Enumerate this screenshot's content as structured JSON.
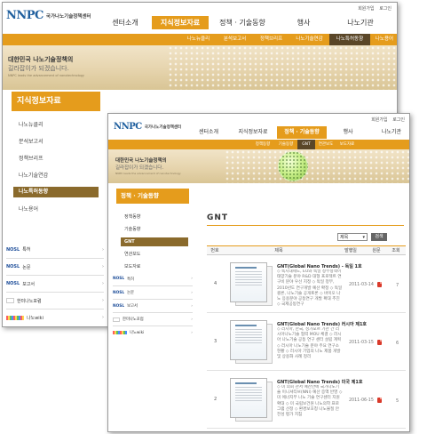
{
  "back": {
    "utility": [
      "회원가입",
      "로그인"
    ],
    "logo_mark": "NNPC",
    "logo_text": "국가나노기술정책센터",
    "gnb": [
      "센터소개",
      "지식정보자료",
      "정책 · 기술동향",
      "행사",
      "나노기관"
    ],
    "gnb_active_index": 1,
    "subnav": [
      "나노뉴클리",
      "분석보고서",
      "정책브리프",
      "나노기술연감",
      "나노특허동향",
      "나노용어"
    ],
    "subnav_active_index": 4,
    "banner_title": "대한민국 나노기술정책의",
    "banner_sub": "길라잡이가 되겠습니다.",
    "banner_tiny": "NNPC leads the advancement of nanotechnology",
    "lnb_title": "지식정보자료",
    "lnb_items": [
      "나노뉴클리",
      "분석보고서",
      "정책브리프",
      "나노기술연감",
      "나노특허동향",
      "나노용어"
    ],
    "lnb_active_index": 4,
    "quick": [
      {
        "logo": "NOSL",
        "label": "특허",
        "icon": "nosl-logo"
      },
      {
        "logo": "NOSL",
        "label": "논문",
        "icon": "nosl-logo"
      },
      {
        "logo": "NOSL",
        "label": "보고서",
        "icon": "nosl-logo"
      },
      {
        "logo": "",
        "label": "한미나노포럼",
        "icon": "korea-flag-icon"
      },
      {
        "logo": "",
        "label": "나노wiki",
        "icon": "wiki-icon"
      }
    ]
  },
  "front": {
    "utility": [
      "회원가입",
      "로그인"
    ],
    "logo_mark": "NNPC",
    "logo_text": "국가나노기술정책센터",
    "gnb": [
      "센터소개",
      "지식정보자료",
      "정책 · 기술동향",
      "행사",
      "나노기관"
    ],
    "gnb_active_index": 2,
    "subnav": [
      "정책동향",
      "기술동향",
      "GNT",
      "연관보도",
      "보도자료"
    ],
    "subnav_active_index": 2,
    "banner_title": "대한민국 나노기술정책의",
    "banner_sub": "길라잡이가 되겠습니다.",
    "banner_tiny": "NNPC leads the advancement of nanotechnology",
    "lnb_title": "정책 · 기술동향",
    "lnb_items": [
      "정책동향",
      "기술동향",
      "GNT",
      "연관보도",
      "보도자료"
    ],
    "lnb_active_index": 2,
    "quick": [
      {
        "logo": "NOSL",
        "label": "특허",
        "icon": "nosl-logo"
      },
      {
        "logo": "NOSL",
        "label": "논문",
        "icon": "nosl-logo"
      },
      {
        "logo": "NOSL",
        "label": "보고서",
        "icon": "nosl-logo"
      },
      {
        "logo": "",
        "label": "한미나노포럼",
        "icon": "korea-flag-icon"
      },
      {
        "logo": "",
        "label": "나노wiki",
        "icon": "wiki-icon"
      }
    ],
    "content_title": "GNT",
    "filter_value": "제목",
    "go_label": "검색",
    "table_headers": [
      "번호",
      "제목",
      "발행일",
      "원문",
      "조회"
    ],
    "rows": [
      {
        "no": "4",
        "title": "GNT(Global Nano Trends) - 독일 1호",
        "desc": "◇ 독시대제도, EU와 독일 정부정책이 태양기술 분야 R&D 대형 프로젝트 연구비 분야 우선 지정 ◇ 독일 정부, 2010년도 연구개발 예산 확정 ◇ 독일 쾰른, 나노기술 공개토론 ◇ 바이오 나노 응용분야 공동연구 개발 확대 추진 ◇ 국제공동연구",
        "date": "2011-03-14",
        "count": "7"
      },
      {
        "no": "3",
        "title": "GNT(Global Nano Trends) 러시아 제1호",
        "desc": "◇ 러시아, 한국, 싱가포르 기관 간 러시아나노기술 협력 MOU 체결 ◇ 러시아 나노기술 공동 연구 센터 설립 계획 ◇ 러시아 나노기술 분야 주요 연구소 현황 ◇ 러시아 기업의 나노 제품 개발 및 상용화 사례 정리",
        "date": "2011-03-15",
        "count": "6"
      },
      {
        "no": "2",
        "title": "GNT(Global Nano Trends) 미국 제1호",
        "desc": "◇ 미 의회 관서 예산안에 국가나노기술 이니셔티브(NNI) 예산 증액 반영 ◇ 미 에너지부 나노 기술 연구센터 지원 확대 ◇ 미 국립보건원 나노의학 프로그램 선정 ◇ 환경보호청 나노물질 안전성 평가 지침",
        "date": "2011-06-15",
        "count": "5"
      }
    ]
  }
}
